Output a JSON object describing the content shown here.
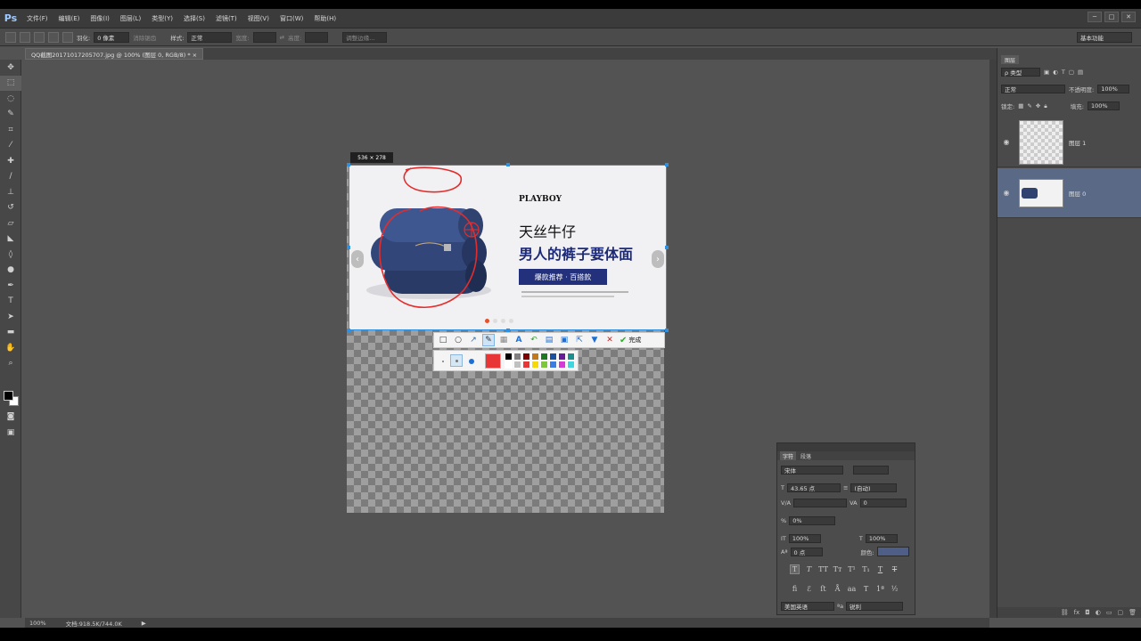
{
  "app": {
    "logo": "Ps"
  },
  "menu": [
    "文件(F)",
    "编辑(E)",
    "图像(I)",
    "图层(L)",
    "类型(Y)",
    "选择(S)",
    "滤镜(T)",
    "视图(V)",
    "窗口(W)",
    "帮助(H)"
  ],
  "window_controls": [
    "─",
    "□",
    "✕"
  ],
  "options": {
    "feather_label": "羽化:",
    "feather_value": "0 像素",
    "antialias_label": "消除锯齿",
    "style_label": "样式:",
    "style_value": "正常",
    "width_label": "宽度:",
    "height_label": "高度:",
    "refine_label": "调整边缘...",
    "workspace": "基本功能"
  },
  "document": {
    "tab_title": "QQ截图20171017205707.jpg @ 100% (图层 0, RGB/8) *  ×"
  },
  "snapshot": {
    "size_label": "536 × 278",
    "banner": {
      "brand": "PLAYBOY",
      "headline1": "天丝牛仔",
      "headline2": "男人的裤子要体面",
      "cta": "爆款推荐 · 百搭款"
    },
    "toolbar": {
      "icons": [
        "rectangle-icon",
        "ellipse-icon",
        "arrow-icon",
        "brush-icon",
        "mosaic-icon",
        "text-icon",
        "undo-icon",
        "save-icon",
        "copy-icon",
        "share-icon",
        "pin-icon",
        "close-icon"
      ],
      "done_label": "完成"
    },
    "current_color": "#e83535",
    "palette": [
      "#000000",
      "#808080",
      "#800000",
      "#c47a1b",
      "#1f7a1f",
      "#1b4fa0",
      "#6a1b9a",
      "#1b8e8e",
      "#ffffff",
      "#c0c0c0",
      "#e83535",
      "#f5d90a",
      "#7cc73a",
      "#3c7ee0",
      "#d63ad6",
      "#3fd6e0"
    ]
  },
  "layers_panel": {
    "tab": "图层",
    "filter": "ρ 类型",
    "blend_mode": "正常",
    "opacity_label": "不透明度:",
    "opacity": "100%",
    "lock_label": "锁定:",
    "fill_label": "填充:",
    "fill": "100%",
    "layers": [
      {
        "name": "图层 1",
        "selected": false
      },
      {
        "name": "图层 0",
        "selected": true
      }
    ]
  },
  "character_panel": {
    "tabs": [
      "字符",
      "段落"
    ],
    "font_family": "宋体",
    "font_size": "43.65 点",
    "leading": "(自动)",
    "tracking": "0",
    "scale_pct": "0%",
    "vscale": "100%",
    "hscale": "100%",
    "baseline": "0 点",
    "color_label": "颜色:",
    "color": "#4f5e87",
    "language": "美国英语",
    "antialias": "锐利"
  },
  "status": {
    "zoom": "100%",
    "doc_info": "文档:918.5K/744.0K"
  }
}
